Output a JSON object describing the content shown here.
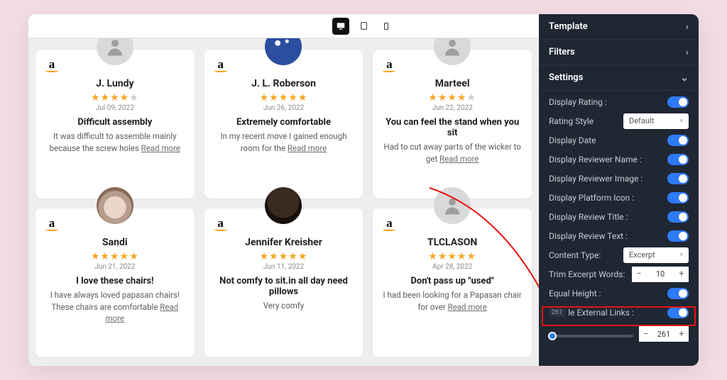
{
  "deviceBar": {
    "desktop": "desktop",
    "tablet": "tablet",
    "mobile": "mobile"
  },
  "reviews": [
    {
      "name": "J. Lundy",
      "rating": 4,
      "date": "Jul 09, 2022",
      "title": "Difficult assembly",
      "body": "It was difficult to assemble mainly because the screw holes",
      "readMore": "Read more",
      "avatar": "default"
    },
    {
      "name": "J. L. Roberson",
      "rating": 5,
      "date": "Jun 26, 2022",
      "title": "Extremely comfortable",
      "body": "In my recent move I gained enough room for the",
      "readMore": "Read more",
      "avatar": "custom1"
    },
    {
      "name": "Marteel",
      "rating": 4,
      "date": "Jun 22, 2022",
      "title": "You can feel the stand when you sit",
      "body": "Had to cut away parts of the wicker to get",
      "readMore": "Read more",
      "avatar": "default"
    },
    {
      "name": "Sandi",
      "rating": 5,
      "date": "Jun 21, 2022",
      "title": "I love these chairs!",
      "body": "I have always loved papasan chairs! These chairs are comfortable",
      "readMore": "Read more",
      "avatar": "custom4"
    },
    {
      "name": "Jennifer Kreisher",
      "rating": 5,
      "date": "Jun 11, 2022",
      "title": "Not comfy to sit.in all day need pillows",
      "body": "Very comfy",
      "readMore": "",
      "avatar": "custom5"
    },
    {
      "name": "TLCLASON",
      "rating": 5,
      "date": "Apr 28, 2022",
      "title": "Don't pass up \"used\"",
      "body": "I had been looking for a Papasan chair for over",
      "readMore": "Read more",
      "avatar": "default"
    }
  ],
  "sidebar": {
    "sections": {
      "template": "Template",
      "filters": "Filters",
      "settings": "Settings"
    },
    "settings": {
      "displayRating": "Display Rating :",
      "ratingStyle": "Rating Style",
      "ratingStyleValue": "Default",
      "displayDate": "Display Date",
      "displayReviewerName": "Display Reviewer Name :",
      "displayReviewerImage": "Display Reviewer Image :",
      "displayPlatformIcon": "Display Platform Icon :",
      "displayReviewTitle": "Display Review Title :",
      "displayReviewText": "Display Review Text :",
      "contentType": "Content Type:",
      "contentTypeValue": "Excerpt",
      "trimExcerpt": "Trim Excerpt Words:",
      "trimExcerptValue": "10",
      "equalHeight": "Equal Height :",
      "externalLinks": "le External Links :",
      "externalBadge": "261",
      "sliderValue": "261",
      "sliderPercent": 4
    }
  }
}
